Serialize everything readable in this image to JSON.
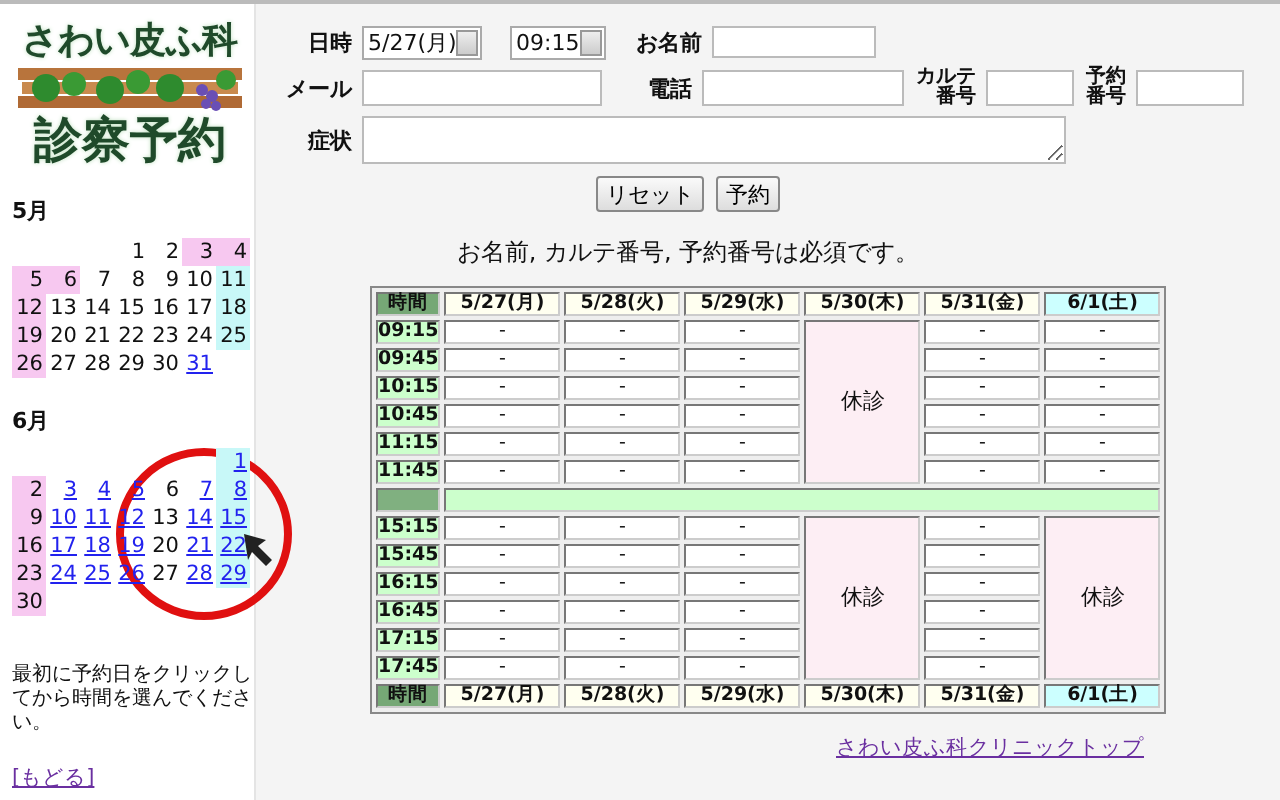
{
  "logo": {
    "line_1": "さわい皮ふ科",
    "line_2": "診察予約"
  },
  "calendar": [
    {
      "month": "5月",
      "weeks": [
        [
          {
            "day": "1",
            "holiday": false,
            "saturday": false,
            "link": false
          },
          {
            "day": "2",
            "holiday": false,
            "saturday": false,
            "link": false
          },
          {
            "day": "3",
            "holiday": true,
            "saturday": false,
            "link": false
          },
          {
            "day": "4",
            "holiday": true,
            "saturday": false,
            "link": false
          }
        ],
        [
          {
            "day": "5",
            "holiday": true,
            "saturday": false,
            "link": false
          },
          {
            "day": "6",
            "holiday": true,
            "saturday": false,
            "link": false
          },
          {
            "day": "7",
            "holiday": false,
            "saturday": false,
            "link": false
          },
          {
            "day": "8",
            "holiday": false,
            "saturday": false,
            "link": false
          },
          {
            "day": "9",
            "holiday": false,
            "saturday": false,
            "link": false
          },
          {
            "day": "10",
            "holiday": false,
            "saturday": false,
            "link": false
          },
          {
            "day": "11",
            "holiday": false,
            "saturday": true,
            "link": false
          }
        ],
        [
          {
            "day": "12",
            "holiday": true,
            "saturday": false,
            "link": false
          },
          {
            "day": "13",
            "holiday": false,
            "saturday": false,
            "link": false
          },
          {
            "day": "14",
            "holiday": false,
            "saturday": false,
            "link": false
          },
          {
            "day": "15",
            "holiday": false,
            "saturday": false,
            "link": false
          },
          {
            "day": "16",
            "holiday": false,
            "saturday": false,
            "link": false
          },
          {
            "day": "17",
            "holiday": false,
            "saturday": false,
            "link": false
          },
          {
            "day": "18",
            "holiday": false,
            "saturday": true,
            "link": false
          }
        ],
        [
          {
            "day": "19",
            "holiday": true,
            "saturday": false,
            "link": false
          },
          {
            "day": "20",
            "holiday": false,
            "saturday": false,
            "link": false
          },
          {
            "day": "21",
            "holiday": false,
            "saturday": false,
            "link": false
          },
          {
            "day": "22",
            "holiday": false,
            "saturday": false,
            "link": false
          },
          {
            "day": "23",
            "holiday": false,
            "saturday": false,
            "link": false
          },
          {
            "day": "24",
            "holiday": false,
            "saturday": false,
            "link": false
          },
          {
            "day": "25",
            "holiday": false,
            "saturday": true,
            "link": false
          }
        ],
        [
          {
            "day": "26",
            "holiday": true,
            "saturday": false,
            "link": false
          },
          {
            "day": "27",
            "holiday": false,
            "saturday": false,
            "link": false
          },
          {
            "day": "28",
            "holiday": false,
            "saturday": false,
            "link": false
          },
          {
            "day": "29",
            "holiday": false,
            "saturday": false,
            "link": false
          },
          {
            "day": "30",
            "holiday": false,
            "saturday": false,
            "link": false
          },
          {
            "day": "31",
            "holiday": false,
            "saturday": false,
            "link": true
          }
        ]
      ]
    },
    {
      "month": "6月",
      "weeks": [
        [
          {
            "day": "1",
            "holiday": false,
            "saturday": true,
            "link": true
          }
        ],
        [
          {
            "day": "2",
            "holiday": true,
            "saturday": false,
            "link": false
          },
          {
            "day": "3",
            "holiday": false,
            "saturday": false,
            "link": true
          },
          {
            "day": "4",
            "holiday": false,
            "saturday": false,
            "link": true
          },
          {
            "day": "5",
            "holiday": false,
            "saturday": false,
            "link": true
          },
          {
            "day": "6",
            "holiday": false,
            "saturday": false,
            "link": false
          },
          {
            "day": "7",
            "holiday": false,
            "saturday": false,
            "link": true
          },
          {
            "day": "8",
            "holiday": false,
            "saturday": true,
            "link": true
          }
        ],
        [
          {
            "day": "9",
            "holiday": true,
            "saturday": false,
            "link": false
          },
          {
            "day": "10",
            "holiday": false,
            "saturday": false,
            "link": true
          },
          {
            "day": "11",
            "holiday": false,
            "saturday": false,
            "link": true
          },
          {
            "day": "12",
            "holiday": false,
            "saturday": false,
            "link": true
          },
          {
            "day": "13",
            "holiday": false,
            "saturday": false,
            "link": false
          },
          {
            "day": "14",
            "holiday": false,
            "saturday": false,
            "link": true
          },
          {
            "day": "15",
            "holiday": false,
            "saturday": true,
            "link": true
          }
        ],
        [
          {
            "day": "16",
            "holiday": true,
            "saturday": false,
            "link": false
          },
          {
            "day": "17",
            "holiday": false,
            "saturday": false,
            "link": true
          },
          {
            "day": "18",
            "holiday": false,
            "saturday": false,
            "link": true
          },
          {
            "day": "19",
            "holiday": false,
            "saturday": false,
            "link": true
          },
          {
            "day": "20",
            "holiday": false,
            "saturday": false,
            "link": false
          },
          {
            "day": "21",
            "holiday": false,
            "saturday": false,
            "link": true
          },
          {
            "day": "22",
            "holiday": false,
            "saturday": true,
            "link": true
          }
        ],
        [
          {
            "day": "23",
            "holiday": true,
            "saturday": false,
            "link": false
          },
          {
            "day": "24",
            "holiday": false,
            "saturday": false,
            "link": true
          },
          {
            "day": "25",
            "holiday": false,
            "saturday": false,
            "link": true
          },
          {
            "day": "26",
            "holiday": false,
            "saturday": false,
            "link": true
          },
          {
            "day": "27",
            "holiday": false,
            "saturday": false,
            "link": false
          },
          {
            "day": "28",
            "holiday": false,
            "saturday": false,
            "link": true
          },
          {
            "day": "29",
            "holiday": false,
            "saturday": true,
            "link": true
          }
        ],
        [
          {
            "day": "30",
            "holiday": true,
            "saturday": false,
            "link": false
          }
        ]
      ]
    }
  ],
  "instruction": "最初に予約日をクリックしてから時間を選んでください。",
  "back_link": "[もどる]",
  "form": {
    "datetime": {
      "label": "日時",
      "date": "5/27(月)",
      "time": "09:15"
    },
    "name": {
      "label": "お名前"
    },
    "email": {
      "label": "メール"
    },
    "phone": {
      "label": "電話"
    },
    "chart_number": {
      "label_lines": [
        "カルテ",
        "番号"
      ]
    },
    "reservation_number": {
      "label_lines": [
        "予約",
        "番号"
      ]
    },
    "symptoms": {
      "label": "症状"
    },
    "buttons": [
      "リセット",
      "予約"
    ]
  },
  "notice": "お名前, カルテ番号, 予約番号は必須です。",
  "table": {
    "header": {
      "time_label": "時間",
      "columns": [
        {
          "label": "5/27(月)",
          "kind": "weekday"
        },
        {
          "label": "5/28(火)",
          "kind": "weekday"
        },
        {
          "label": "5/29(水)",
          "kind": "weekday"
        },
        {
          "label": "5/30(木)",
          "kind": "weekday"
        },
        {
          "label": "5/31(金)",
          "kind": "weekday"
        },
        {
          "label": "6/1(土)",
          "kind": "saturday"
        }
      ]
    },
    "sessions": [
      {
        "times": [
          "09:15",
          "09:45",
          "10:15",
          "10:45",
          "11:15",
          "11:45"
        ],
        "columns": [
          {
            "kind": "slots",
            "cells": [
              "-",
              "-",
              "-",
              "-",
              "-",
              "-"
            ]
          },
          {
            "kind": "slots",
            "cells": [
              "-",
              "-",
              "-",
              "-",
              "-",
              "-"
            ]
          },
          {
            "kind": "slots",
            "cells": [
              "-",
              "-",
              "-",
              "-",
              "-",
              "-"
            ]
          },
          {
            "kind": "closed",
            "label": "休診"
          },
          {
            "kind": "slots",
            "cells": [
              "-",
              "-",
              "-",
              "-",
              "-",
              "-"
            ]
          },
          {
            "kind": "slots",
            "cells": [
              "-",
              "-",
              "-",
              "-",
              "-",
              "-"
            ]
          }
        ]
      },
      {
        "times": [
          "15:15",
          "15:45",
          "16:15",
          "16:45",
          "17:15",
          "17:45"
        ],
        "columns": [
          {
            "kind": "slots",
            "cells": [
              "-",
              "-",
              "-",
              "-",
              "-",
              "-"
            ]
          },
          {
            "kind": "slots",
            "cells": [
              "-",
              "-",
              "-",
              "-",
              "-",
              "-"
            ]
          },
          {
            "kind": "slots",
            "cells": [
              "-",
              "-",
              "-",
              "-",
              "-",
              "-"
            ]
          },
          {
            "kind": "closed",
            "label": "休診"
          },
          {
            "kind": "slots",
            "cells": [
              "-",
              "-",
              "-",
              "-",
              "-",
              "-"
            ]
          },
          {
            "kind": "closed",
            "label": "休診"
          }
        ]
      }
    ],
    "footer": {
      "time_label": "時間",
      "columns": [
        {
          "label": "5/27(月)",
          "kind": "weekday"
        },
        {
          "label": "5/28(火)",
          "kind": "weekday"
        },
        {
          "label": "5/29(水)",
          "kind": "weekday"
        },
        {
          "label": "5/30(木)",
          "kind": "weekday"
        },
        {
          "label": "5/31(金)",
          "kind": "weekday"
        },
        {
          "label": "6/1(土)",
          "kind": "saturday"
        }
      ]
    }
  },
  "footer_link": "さわい皮ふ科クリニックトップ"
}
